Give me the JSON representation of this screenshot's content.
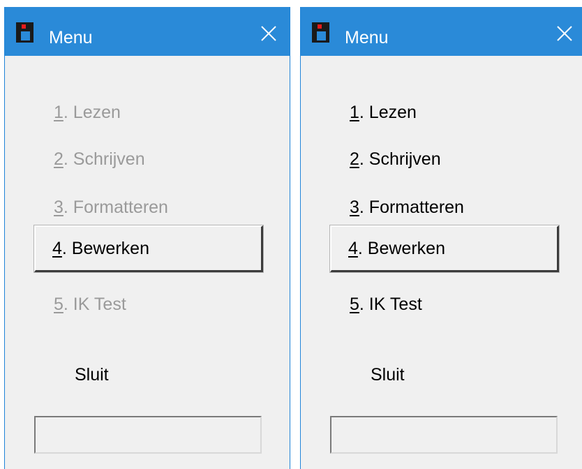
{
  "windows": [
    {
      "title": "Menu",
      "items": [
        {
          "num": "1",
          "label": ". Lezen",
          "enabled": false
        },
        {
          "num": "2",
          "label": ". Schrijven",
          "enabled": false
        },
        {
          "num": "3",
          "label": ". Formatteren",
          "enabled": false
        },
        {
          "num": "4",
          "label": ". Bewerken",
          "enabled": true
        },
        {
          "num": "5",
          "label": ". IK Test",
          "enabled": false
        }
      ],
      "close_label": "Sluit",
      "status_value": ""
    },
    {
      "title": "Menu",
      "items": [
        {
          "num": "1",
          "label": ". Lezen",
          "enabled": true
        },
        {
          "num": "2",
          "label": ". Schrijven",
          "enabled": true
        },
        {
          "num": "3",
          "label": ". Formatteren",
          "enabled": true
        },
        {
          "num": "4",
          "label": ". Bewerken",
          "enabled": true
        },
        {
          "num": "5",
          "label": ". IK Test",
          "enabled": true
        }
      ],
      "close_label": "Sluit",
      "status_value": ""
    }
  ],
  "icons": {
    "app": "app-icon",
    "close": "close-icon"
  },
  "colors": {
    "titlebar": "#2a8ad8",
    "disabled_text": "#9a9a9a",
    "window_bg": "#f0f0f0"
  }
}
